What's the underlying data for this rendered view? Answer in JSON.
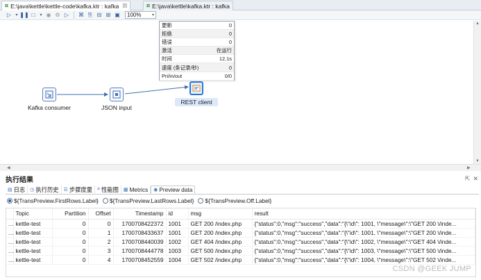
{
  "tabs": [
    {
      "label": "E:\\java\\kettle\\kettle-code\\kafka.ktr : kafka",
      "active": true,
      "close": "☒"
    },
    {
      "label": "E:\\java\\kettle\\kafka.ktr : kafka",
      "active": false
    }
  ],
  "toolbar": {
    "zoom": "100%"
  },
  "canvas": {
    "steps": [
      {
        "label": "Kafka consumer",
        "icon": "kafka-consumer-icon"
      },
      {
        "label": "JSON input",
        "icon": "json-input-icon"
      },
      {
        "label": "REST client",
        "icon": "rest-client-icon",
        "selected": true
      }
    ]
  },
  "metrics": [
    {
      "label": "更新",
      "value": "0"
    },
    {
      "label": "拒绝",
      "value": "0"
    },
    {
      "label": "错误",
      "value": "0"
    },
    {
      "label": "激活",
      "value": "在运行"
    },
    {
      "label": "时间",
      "value": "12.1s"
    },
    {
      "label": "速度 (条记录/秒)",
      "value": "0"
    },
    {
      "label": "Pri/in/out",
      "value": "0/0"
    }
  ],
  "results": {
    "title": "执行结果",
    "subtabs": [
      {
        "label": "日志",
        "icon": "log-icon"
      },
      {
        "label": "执行历史",
        "icon": "history-icon"
      },
      {
        "label": "步骤度量",
        "icon": "step-metrics-icon"
      },
      {
        "label": "性能图",
        "icon": "performance-chart-icon"
      },
      {
        "label": "Metrics",
        "icon": "metrics-icon"
      },
      {
        "label": "Preview data",
        "icon": "preview-data-icon",
        "active": true
      }
    ],
    "radios": [
      {
        "label": "${TransPreview.FirstRows.Label}",
        "checked": true
      },
      {
        "label": "${TransPreview.LastRows.Label}",
        "checked": false
      },
      {
        "label": "${TransPreview.Off.Label}",
        "checked": false
      }
    ],
    "columns": [
      "",
      "Topic",
      "Partition",
      "Offset",
      "Timestamp",
      "id",
      "msg",
      "result"
    ],
    "rows": [
      [
        "..",
        "kettle-test",
        "0",
        "0",
        "1700708422372",
        "1001",
        "GET 200 /index.php",
        "{\"status\":0,\"msg\":\"success\",\"data\":\"{\\\"id\\\": 1001, \\\"message\\\":\\\"GET 200 \\/inde..."
      ],
      [
        "..",
        "kettle-test",
        "0",
        "1",
        "1700708433637",
        "1001",
        "GET 200 /index.php",
        "{\"status\":0,\"msg\":\"success\",\"data\":\"{\\\"id\\\": 1001, \\\"message\\\":\\\"GET 200 \\/inde..."
      ],
      [
        "..",
        "kettle-test",
        "0",
        "2",
        "1700708440039",
        "1002",
        "GET 404 /index.php",
        "{\"status\":0,\"msg\":\"success\",\"data\":\"{\\\"id\\\": 1002, \\\"message\\\":\\\"GET 404 \\/inde..."
      ],
      [
        "..",
        "kettle-test",
        "0",
        "3",
        "1700708444778",
        "1003",
        "GET 500 /index.php",
        "{\"status\":0,\"msg\":\"success\",\"data\":\"{\\\"id\\\": 1003, \\\"message\\\":\\\"GET 500 \\/inde..."
      ],
      [
        "..",
        "kettle-test",
        "0",
        "4",
        "1700708452559",
        "1004",
        "GET 502 /index.php",
        "{\"status\":0,\"msg\":\"success\",\"data\":\"{\\\"id\\\": 1004, \\\"message\\\":\\\"GET 502 \\/inde..."
      ]
    ]
  },
  "watermark": "CSDN @GEEK JUMP"
}
